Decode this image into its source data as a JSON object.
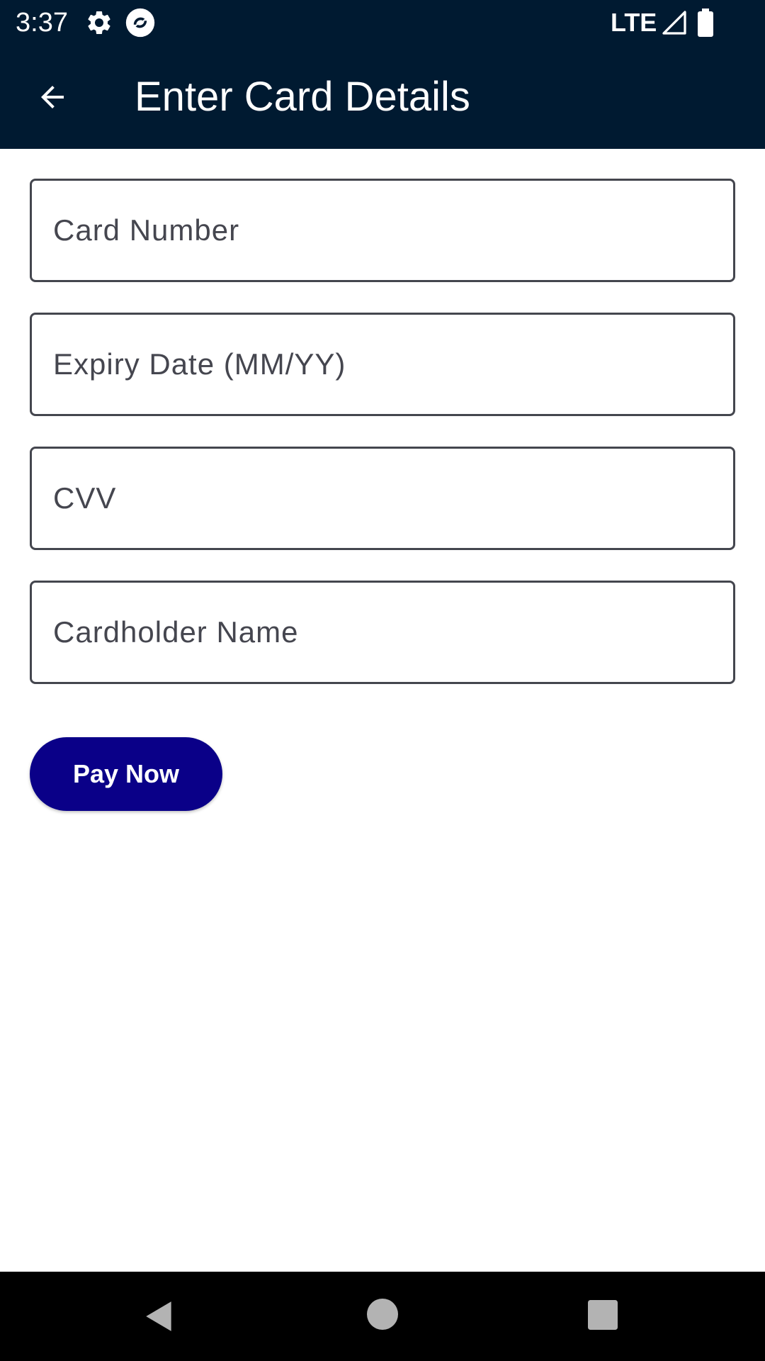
{
  "status_bar": {
    "time": "3:37",
    "network": "LTE",
    "icons": [
      "gear-icon",
      "app-sync-icon",
      "signal-icon",
      "battery-icon"
    ]
  },
  "app_bar": {
    "title": "Enter Card Details",
    "back_icon": "arrow-back-icon",
    "background": "#001a31"
  },
  "form": {
    "card_number": {
      "placeholder": "Card Number",
      "value": ""
    },
    "expiry_date": {
      "placeholder": "Expiry Date (MM/YY)",
      "value": ""
    },
    "cvv": {
      "placeholder": "CVV",
      "value": ""
    },
    "cardholder_name": {
      "placeholder": "Cardholder Name",
      "value": ""
    }
  },
  "actions": {
    "pay_label": "Pay Now",
    "pay_color": "#0a0088"
  },
  "nav_bar": {
    "icons": [
      "nav-back-icon",
      "nav-home-icon",
      "nav-recents-icon"
    ]
  }
}
